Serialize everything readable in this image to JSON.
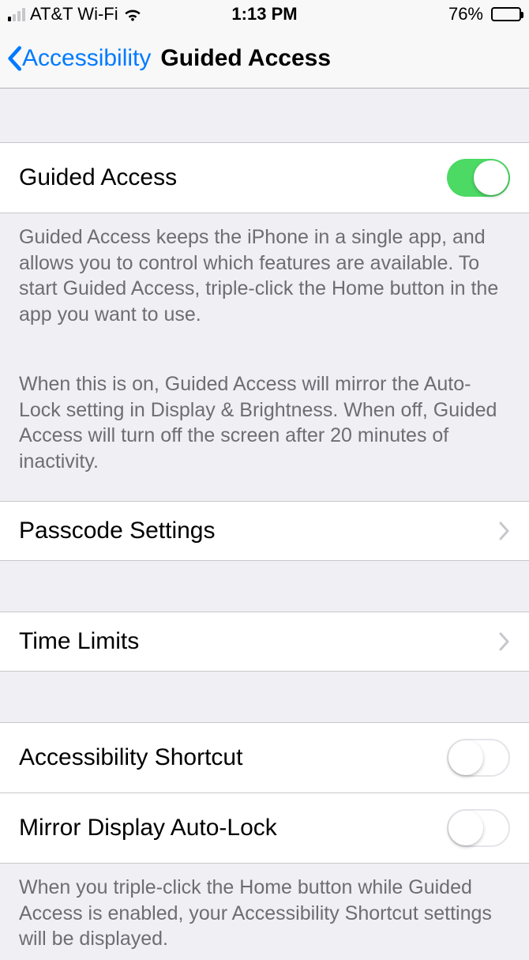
{
  "status": {
    "carrier": "AT&T Wi-Fi",
    "time": "1:13 PM",
    "battery_pct": "76%"
  },
  "nav": {
    "back_label": "Accessibility",
    "title": "Guided Access"
  },
  "rows": {
    "guided_access": {
      "label": "Guided Access",
      "on": true
    },
    "passcode": {
      "label": "Passcode Settings"
    },
    "time_limits": {
      "label": "Time Limits"
    },
    "shortcut": {
      "label": "Accessibility Shortcut",
      "on": false
    },
    "mirror": {
      "label": "Mirror Display Auto-Lock",
      "on": false
    }
  },
  "footers": {
    "f1a": "Guided Access keeps the iPhone in a single app, and allows you to control which features are available. To start Guided Access, triple-click the Home button in the app you want to use.",
    "f1b": "When this is on, Guided Access will mirror the Auto-Lock setting in Display & Brightness. When off, Guided Access will turn off the screen after 20 minutes of inactivity.",
    "f2": "When you triple-click the Home button while Guided Access is enabled, your Accessibility Shortcut settings will be displayed."
  }
}
